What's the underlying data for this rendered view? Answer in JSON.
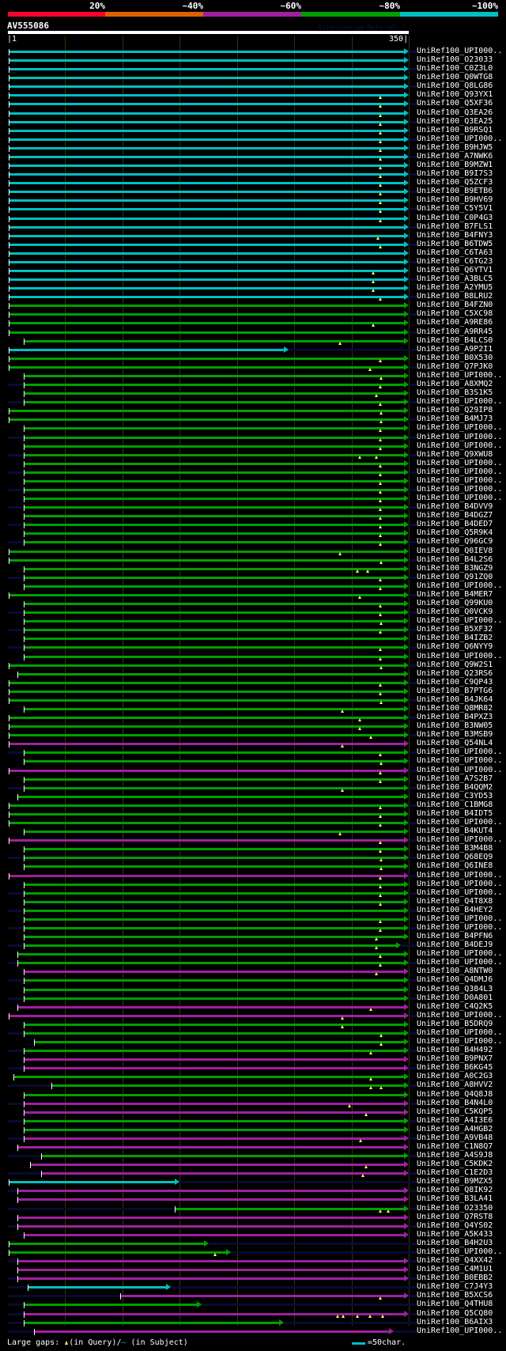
{
  "legend": {
    "labels": [
      "20%",
      "~40%",
      "~60%",
      "~80%",
      "~100%"
    ],
    "colors": [
      "#ff0030",
      "#e06000",
      "#a020a0",
      "#00a000",
      "#00c0c0"
    ]
  },
  "query": {
    "name": "AV555086",
    "start": "1",
    "end": "350",
    "length": 350
  },
  "version": "AlignView.pm Beta rel.7",
  "color_map": {
    "c": "#00c0c0",
    "g": "#00a000",
    "m": "#a020a0"
  },
  "rows": [
    [
      "UniRef100_UPI000..",
      "c",
      1,
      350,
      []
    ],
    [
      "UniRef100_O23033",
      "c",
      1,
      350,
      []
    ],
    [
      "UniRef100_C0Z3L0",
      "c",
      1,
      350,
      []
    ],
    [
      "UniRef100_Q0WTG8",
      "c",
      1,
      350,
      []
    ],
    [
      "UniRef100_Q8LG86",
      "c",
      1,
      350,
      []
    ],
    [
      "UniRef100_Q93YX1",
      "c",
      1,
      350,
      [
        325
      ]
    ],
    [
      "UniRef100_Q5XF36",
      "c",
      1,
      350,
      [
        325
      ]
    ],
    [
      "UniRef100_Q3EA26",
      "c",
      1,
      350,
      [
        325
      ]
    ],
    [
      "UniRef100_Q3EA25",
      "c",
      1,
      350,
      [
        325
      ]
    ],
    [
      "UniRef100_B9RSQ1",
      "c",
      1,
      350,
      [
        325
      ]
    ],
    [
      "UniRef100_UPI000..",
      "c",
      1,
      350,
      [
        325
      ]
    ],
    [
      "UniRef100_B9HJW5",
      "c",
      1,
      350,
      [
        325
      ]
    ],
    [
      "UniRef100_A7NWK6",
      "c",
      1,
      350,
      [
        325
      ]
    ],
    [
      "UniRef100_B9MZW1",
      "c",
      1,
      350,
      [
        325
      ]
    ],
    [
      "UniRef100_B9I7S3",
      "c",
      1,
      350,
      [
        325
      ]
    ],
    [
      "UniRef100_Q5ZCF3",
      "c",
      1,
      350,
      [
        325
      ]
    ],
    [
      "UniRef100_B9ETB6",
      "c",
      1,
      350,
      [
        325
      ]
    ],
    [
      "UniRef100_B9HV69",
      "c",
      1,
      350,
      [
        325
      ]
    ],
    [
      "UniRef100_C5Y5V1",
      "c",
      1,
      350,
      [
        325
      ]
    ],
    [
      "UniRef100_C0P4G3",
      "c",
      1,
      350,
      [
        325
      ]
    ],
    [
      "UniRef100_B7FLS1",
      "c",
      1,
      350,
      []
    ],
    [
      "UniRef100_B4FNY3",
      "c",
      1,
      350,
      [
        323
      ]
    ],
    [
      "UniRef100_B6TDW5",
      "c",
      1,
      350,
      [
        325
      ]
    ],
    [
      "UniRef100_C6TA63",
      "c",
      1,
      350,
      []
    ],
    [
      "UniRef100_C6TG23",
      "c",
      1,
      350,
      []
    ],
    [
      "UniRef100_Q6YTV1",
      "c",
      1,
      350,
      [
        319
      ]
    ],
    [
      "UniRef100_A3BLC5",
      "c",
      1,
      350,
      [
        319
      ]
    ],
    [
      "UniRef100_A2YMU5",
      "c",
      1,
      350,
      [
        319
      ]
    ],
    [
      "UniRef100_B8LRU2",
      "c",
      1,
      350,
      [
        325
      ]
    ],
    [
      "UniRef100_B4FZN0",
      "g",
      1,
      350,
      []
    ],
    [
      "UniRef100_C5XC98",
      "g",
      1,
      350,
      []
    ],
    [
      "UniRef100_A9RE86",
      "g",
      1,
      350,
      [
        319
      ]
    ],
    [
      "UniRef100_A9RR45",
      "g",
      1,
      350,
      []
    ],
    [
      "UniRef100_B4LCS0",
      "g",
      14,
      350,
      [
        290
      ]
    ],
    [
      "UniRef100_A9P2I1",
      "c",
      1,
      245,
      []
    ],
    [
      "UniRef100_B0X530",
      "g",
      1,
      350,
      [
        325
      ]
    ],
    [
      "UniRef100_Q7PJK0",
      "g",
      1,
      350,
      [
        316
      ]
    ],
    [
      "UniRef100_UPI000..",
      "g",
      14,
      350,
      [
        326
      ]
    ],
    [
      "UniRef100_A8XMQ2",
      "g",
      14,
      350,
      [
        325
      ]
    ],
    [
      "UniRef100_B3S1K5",
      "g",
      14,
      350,
      [
        322
      ]
    ],
    [
      "UniRef100_UPI000..",
      "g",
      14,
      350,
      [
        325
      ]
    ],
    [
      "UniRef100_Q29IP8",
      "g",
      1,
      350,
      [
        326
      ]
    ],
    [
      "UniRef100_B4MJ73",
      "g",
      1,
      350,
      [
        326
      ]
    ],
    [
      "UniRef100_UPI000..",
      "g",
      14,
      350,
      [
        325
      ]
    ],
    [
      "UniRef100_UPI000..",
      "g",
      14,
      350,
      [
        325
      ]
    ],
    [
      "UniRef100_UPI000..",
      "g",
      14,
      350,
      [
        325
      ]
    ],
    [
      "UniRef100_Q9XWU8",
      "g",
      14,
      350,
      [
        307,
        322
      ]
    ],
    [
      "UniRef100_UPI000..",
      "g",
      14,
      350,
      [
        325
      ]
    ],
    [
      "UniRef100_UPI000..",
      "g",
      14,
      350,
      [
        325
      ]
    ],
    [
      "UniRef100_UPI000..",
      "g",
      14,
      350,
      [
        325
      ]
    ],
    [
      "UniRef100_UPI000..",
      "g",
      14,
      350,
      [
        325
      ]
    ],
    [
      "UniRef100_UPI000..",
      "g",
      14,
      350,
      [
        325
      ]
    ],
    [
      "UniRef100_B4DVV9",
      "g",
      14,
      350,
      [
        325
      ]
    ],
    [
      "UniRef100_B4DGZ7",
      "g",
      14,
      350,
      [
        325
      ]
    ],
    [
      "UniRef100_B4DED7",
      "g",
      14,
      350,
      [
        325
      ]
    ],
    [
      "UniRef100_Q5R9K4",
      "g",
      14,
      350,
      [
        325
      ]
    ],
    [
      "UniRef100_Q96GC9",
      "g",
      14,
      350,
      [
        325
      ]
    ],
    [
      "UniRef100_Q0IEV8",
      "g",
      1,
      350,
      [
        290
      ]
    ],
    [
      "UniRef100_B4L2S6",
      "g",
      1,
      350,
      [
        326
      ]
    ],
    [
      "UniRef100_B3NGZ9",
      "g",
      14,
      350,
      [
        305,
        314
      ]
    ],
    [
      "UniRef100_Q91ZQ0",
      "g",
      14,
      350,
      [
        325
      ]
    ],
    [
      "UniRef100_UPI000..",
      "g",
      14,
      350,
      [
        325
      ]
    ],
    [
      "UniRef100_B4MER7",
      "g",
      1,
      350,
      [
        307
      ]
    ],
    [
      "UniRef100_Q99KU0",
      "g",
      14,
      350,
      [
        325
      ]
    ],
    [
      "UniRef100_Q0VCK9",
      "g",
      14,
      350,
      [
        325
      ]
    ],
    [
      "UniRef100_UPI000..",
      "g",
      14,
      350,
      [
        326
      ]
    ],
    [
      "UniRef100_B5XF32",
      "g",
      14,
      350,
      [
        325
      ]
    ],
    [
      "UniRef100_B4IZB2",
      "g",
      14,
      350,
      []
    ],
    [
      "UniRef100_Q6NYY9",
      "g",
      14,
      350,
      [
        325
      ]
    ],
    [
      "UniRef100_UPI000..",
      "g",
      14,
      350,
      [
        325
      ]
    ],
    [
      "UniRef100_Q9W2S1",
      "g",
      1,
      350,
      [
        326
      ]
    ],
    [
      "UniRef100_Q23RS6",
      "g",
      8,
      350,
      []
    ],
    [
      "UniRef100_C9QP43",
      "g",
      1,
      350,
      [
        325
      ]
    ],
    [
      "UniRef100_B7PTG6",
      "g",
      1,
      350,
      [
        325
      ]
    ],
    [
      "UniRef100_B4JK64",
      "g",
      1,
      350,
      [
        326
      ]
    ],
    [
      "UniRef100_Q8MR82",
      "g",
      14,
      350,
      [
        292
      ]
    ],
    [
      "UniRef100_B4PXZ3",
      "g",
      1,
      350,
      [
        307
      ]
    ],
    [
      "UniRef100_B3NW05",
      "g",
      1,
      350,
      [
        307
      ]
    ],
    [
      "UniRef100_B3MSB9",
      "g",
      1,
      350,
      [
        317
      ]
    ],
    [
      "UniRef100_Q54NL4",
      "m",
      1,
      350,
      [
        292
      ]
    ],
    [
      "UniRef100_UPI000..",
      "g",
      14,
      350,
      [
        325
      ]
    ],
    [
      "UniRef100_UPI000..",
      "g",
      14,
      350,
      [
        326
      ]
    ],
    [
      "UniRef100_UPI000..",
      "m",
      1,
      350,
      [
        325
      ]
    ],
    [
      "UniRef100_A7S2B7",
      "g",
      14,
      350,
      [
        325
      ]
    ],
    [
      "UniRef100_B4QQM2",
      "g",
      14,
      350,
      [
        292
      ]
    ],
    [
      "UniRef100_C3YD53",
      "g",
      8,
      350,
      []
    ],
    [
      "UniRef100_C1BMG8",
      "g",
      1,
      350,
      [
        325
      ]
    ],
    [
      "UniRef100_B4IDT5",
      "g",
      1,
      350,
      [
        325
      ]
    ],
    [
      "UniRef100_UPI000..",
      "g",
      1,
      350,
      [
        325
      ]
    ],
    [
      "UniRef100_B4KUT4",
      "g",
      14,
      350,
      [
        290
      ]
    ],
    [
      "UniRef100_UPI000..",
      "m",
      1,
      350,
      [
        325
      ]
    ],
    [
      "UniRef100_B3M4B8",
      "g",
      14,
      350,
      [
        325
      ]
    ],
    [
      "UniRef100_Q68EQ9",
      "g",
      14,
      350,
      [
        326
      ]
    ],
    [
      "UniRef100_Q6INE8",
      "g",
      14,
      350,
      [
        326
      ]
    ],
    [
      "UniRef100_UPI000..",
      "m",
      1,
      350,
      [
        325
      ]
    ],
    [
      "UniRef100_UPI000..",
      "g",
      14,
      350,
      [
        325
      ]
    ],
    [
      "UniRef100_UPI000..",
      "g",
      14,
      350,
      [
        325
      ]
    ],
    [
      "UniRef100_Q4T8X8",
      "g",
      14,
      350,
      [
        325
      ]
    ],
    [
      "UniRef100_B4HEY2",
      "g",
      14,
      350,
      []
    ],
    [
      "UniRef100_UPI000..",
      "g",
      14,
      350,
      [
        325
      ]
    ],
    [
      "UniRef100_UPI000..",
      "g",
      14,
      350,
      [
        325
      ]
    ],
    [
      "UniRef100_B4PFN6",
      "g",
      14,
      350,
      [
        322
      ]
    ],
    [
      "UniRef100_B4DEJ9",
      "g",
      14,
      343,
      [
        322
      ]
    ],
    [
      "UniRef100_UPI000..",
      "g",
      8,
      350,
      [
        325
      ]
    ],
    [
      "UniRef100_UPI000..",
      "g",
      8,
      350,
      [
        325
      ]
    ],
    [
      "UniRef100_A8NTW0",
      "m",
      14,
      350,
      [
        322
      ]
    ],
    [
      "UniRef100_Q4DMJ6",
      "g",
      14,
      350,
      []
    ],
    [
      "UniRef100_Q384L3",
      "g",
      14,
      350,
      []
    ],
    [
      "UniRef100_D0A801",
      "g",
      14,
      350,
      []
    ],
    [
      "UniRef100_C4Q2K5",
      "m",
      8,
      350,
      [
        317
      ]
    ],
    [
      "UniRef100_UPI000..",
      "m",
      1,
      350,
      [
        292
      ]
    ],
    [
      "UniRef100_B5DRQ9",
      "g",
      14,
      350,
      [
        292
      ]
    ],
    [
      "UniRef100_UPI000..",
      "g",
      14,
      350,
      [
        326
      ]
    ],
    [
      "UniRef100_UPI000..",
      "g",
      23,
      350,
      [
        326
      ]
    ],
    [
      "UniRef100_B4H492",
      "g",
      14,
      350,
      [
        317
      ]
    ],
    [
      "UniRef100_B9PNX7",
      "m",
      14,
      350,
      []
    ],
    [
      "UniRef100_B6KG45",
      "m",
      14,
      350,
      []
    ],
    [
      "UniRef100_A0C2G3",
      "g",
      5,
      350,
      [
        317
      ]
    ],
    [
      "UniRef100_A8HVV2",
      "g",
      38,
      350,
      [
        317,
        326
      ]
    ],
    [
      "UniRef100_Q4Q8J8",
      "g",
      14,
      350,
      []
    ],
    [
      "UniRef100_B4N4L0",
      "m",
      14,
      350,
      [
        298
      ]
    ],
    [
      "UniRef100_C5KQP5",
      "m",
      14,
      350,
      [
        313
      ]
    ],
    [
      "UniRef100_A4I3E6",
      "g",
      14,
      350,
      []
    ],
    [
      "UniRef100_A4HGB2",
      "g",
      14,
      350,
      []
    ],
    [
      "UniRef100_A9VB48",
      "m",
      14,
      350,
      [
        308
      ]
    ],
    [
      "UniRef100_C1N8Q7",
      "m",
      8,
      350,
      []
    ],
    [
      "UniRef100_A4S9J8",
      "g",
      29,
      350,
      []
    ],
    [
      "UniRef100_C5KDK2",
      "m",
      19,
      350,
      [
        313
      ]
    ],
    [
      "UniRef100_C1E2D3",
      "m",
      29,
      350,
      [
        310
      ]
    ],
    [
      "UniRef100_B9MZX5",
      "c",
      1,
      150,
      []
    ],
    [
      "UniRef100_Q8IK92",
      "m",
      8,
      350,
      []
    ],
    [
      "UniRef100_B3LA41",
      "m",
      8,
      350,
      []
    ],
    [
      "UniRef100_O23350",
      "g",
      146,
      350,
      [
        325,
        332
      ]
    ],
    [
      "UniRef100_Q7RST8",
      "m",
      8,
      350,
      []
    ],
    [
      "UniRef100_Q4YS02",
      "m",
      8,
      350,
      []
    ],
    [
      "UniRef100_A5K433",
      "m",
      14,
      350,
      []
    ],
    [
      "UniRef100_B4H2U3",
      "g",
      1,
      175,
      []
    ],
    [
      "UniRef100_UPI000..",
      "g",
      1,
      195,
      [
        181
      ]
    ],
    [
      "UniRef100_Q4XX42",
      "m",
      8,
      350,
      []
    ],
    [
      "UniRef100_C4M1U1",
      "m",
      8,
      350,
      []
    ],
    [
      "UniRef100_B0EBB2",
      "m",
      8,
      350,
      []
    ],
    [
      "UniRef100_C7J4Y3",
      "c",
      17,
      142,
      []
    ],
    [
      "UniRef100_B5XCS6",
      "m",
      98,
      350,
      [
        325
      ]
    ],
    [
      "UniRef100_Q4THU8",
      "g",
      14,
      169,
      []
    ],
    [
      "UniRef100_Q5CQ80",
      "m",
      14,
      350,
      [
        288,
        293,
        305,
        316,
        327
      ]
    ],
    [
      "UniRef100_B6AIX3",
      "g",
      14,
      241,
      []
    ],
    [
      "UniRef100_UPI000..",
      "m",
      23,
      337,
      []
    ]
  ],
  "footer": {
    "gaps_label": "Large gaps:",
    "query_label": "(in Query)/",
    "dash": "–",
    "subject_label": " (in Subject)",
    "scale_label": "=50char."
  }
}
